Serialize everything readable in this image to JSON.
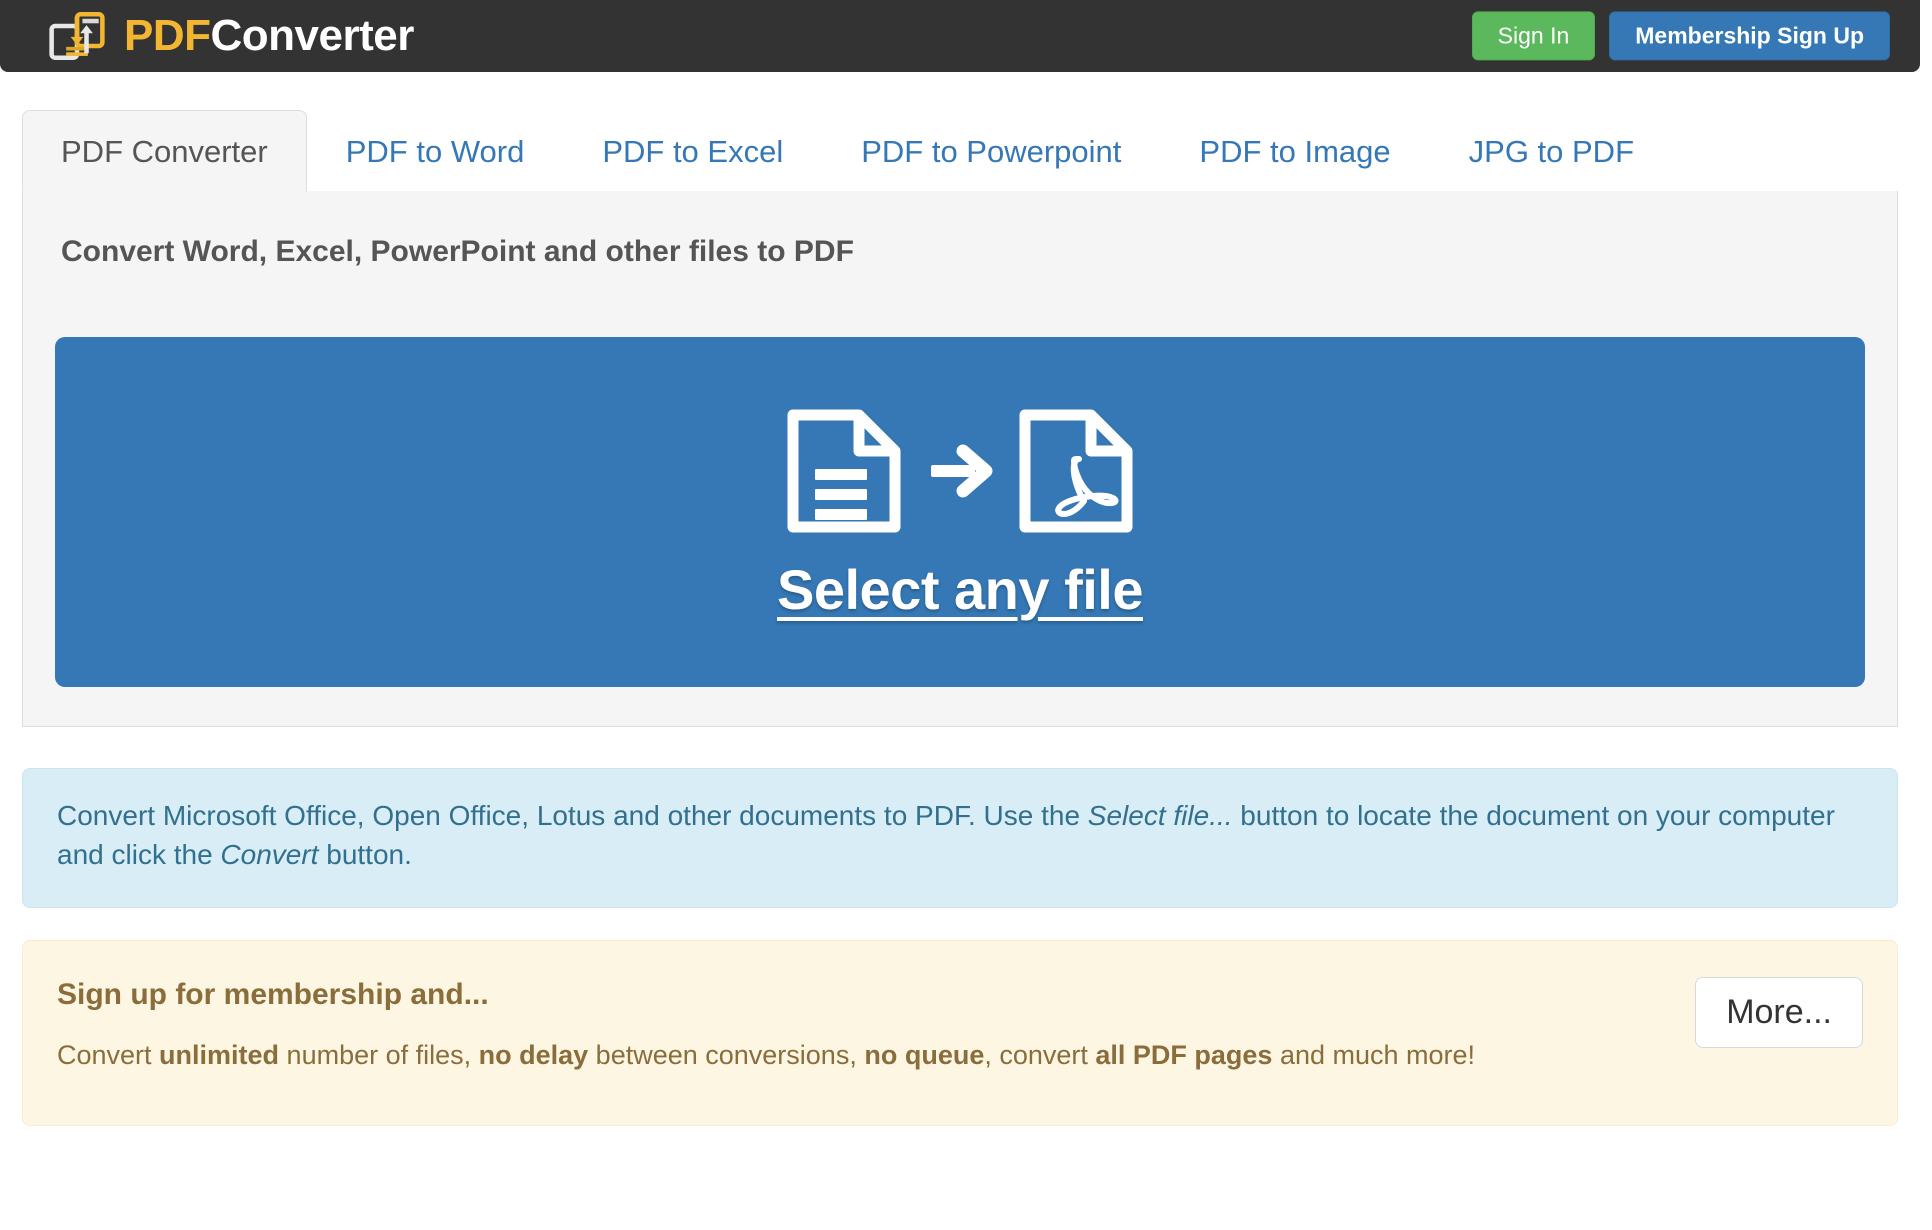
{
  "header": {
    "logo_icon": "pdf-convert-documents-icon",
    "brand_primary": "PDF",
    "brand_secondary": "Converter",
    "sign_in_label": "Sign In",
    "sign_up_label": "Membership Sign Up",
    "bg_color": "#333333",
    "brand_accent_color": "#f2b632",
    "sign_in_color": "#5cb85c",
    "sign_up_color": "#3578b5"
  },
  "tabs": [
    {
      "label": "PDF Converter",
      "active": true
    },
    {
      "label": "PDF to Word",
      "active": false
    },
    {
      "label": "PDF to Excel",
      "active": false
    },
    {
      "label": "PDF to Powerpoint",
      "active": false
    },
    {
      "label": "PDF to Image",
      "active": false
    },
    {
      "label": "JPG to PDF",
      "active": false
    }
  ],
  "panel": {
    "title": "Convert Word, Excel, PowerPoint and other files to PDF",
    "dropzone": {
      "label": "Select any file",
      "bg_color": "#3578b5",
      "source_icon": "document-file-icon",
      "arrow_icon": "arrow-right-icon",
      "target_icon": "pdf-file-icon"
    }
  },
  "info_box": {
    "text_part_1": "Convert Microsoft Office, Open Office, Lotus and other documents to PDF. Use the ",
    "emphasis_1": "Select file...",
    "text_part_2": " button to locate the document on your computer and click the ",
    "emphasis_2": "Convert",
    "text_part_3": " button.",
    "bg_color": "#d9edf7",
    "text_color": "#31708f"
  },
  "membership_box": {
    "title": "Sign up for membership and...",
    "text_part_1": "Convert ",
    "bold_1": "unlimited",
    "text_part_2": " number of files, ",
    "bold_2": "no delay",
    "text_part_3": " between conversions, ",
    "bold_3": "no queue",
    "text_part_4": ", convert ",
    "bold_4": "all PDF pages",
    "text_part_5": " and much more!",
    "more_label": "More...",
    "bg_color": "#fcf6e3",
    "text_color": "#8a6d3b"
  }
}
